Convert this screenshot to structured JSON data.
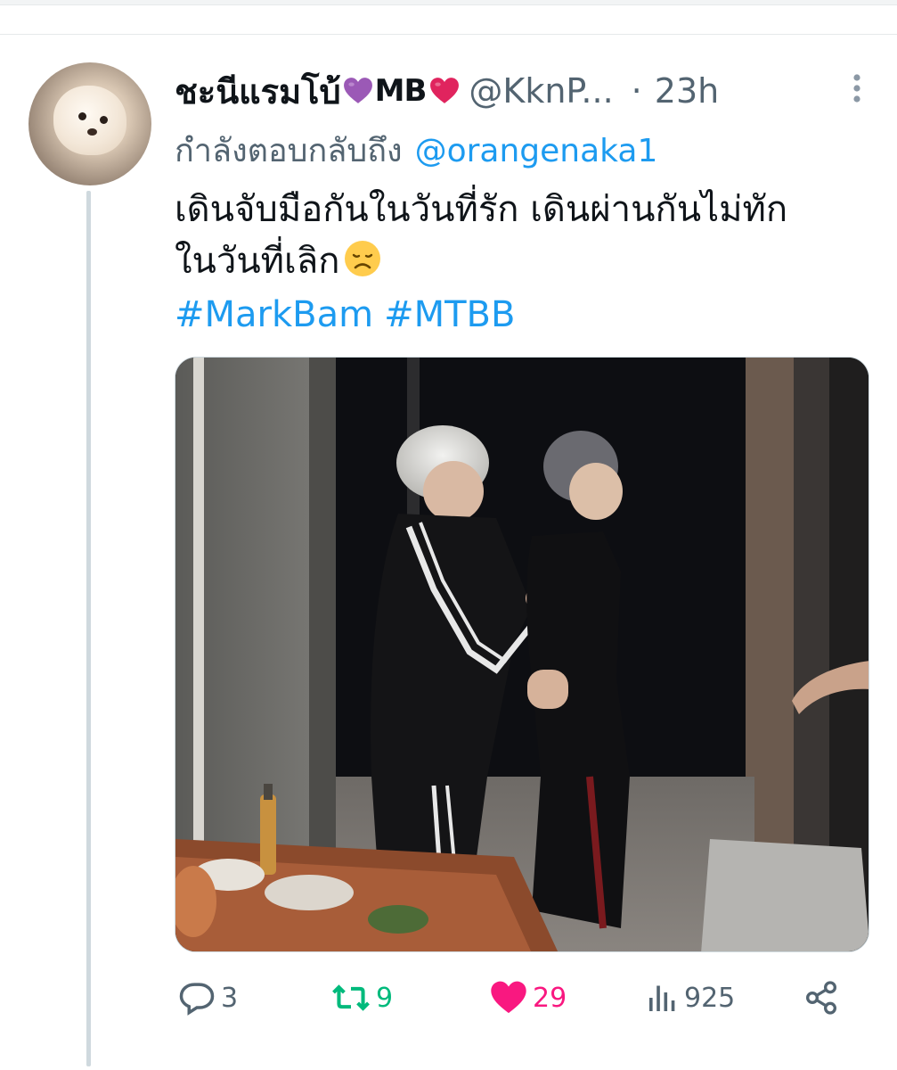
{
  "tweet": {
    "display_name": "ชะนีแรมโบ้",
    "name_suffix": "MB",
    "handle": "@KknP...",
    "dot": "·",
    "time": "23h",
    "reply_prefix": "กำลังตอบกลับถึง",
    "reply_mention": "@orangenaka1",
    "text_line1": "เดินจับมือกันในวันที่รัก เดินผ่านกันไม่ทัก",
    "text_line2": "ในวันที่เลิก",
    "hashtags": [
      "#MarkBam",
      "#MTBB"
    ]
  },
  "actions": {
    "replies": "3",
    "retweets": "9",
    "likes": "29",
    "views": "925"
  },
  "colors": {
    "accent": "#1d9bf0",
    "muted": "#536471",
    "retweet": "#00ba7c",
    "like": "#f91880",
    "purple_heart": "#9b59b6",
    "red_heart": "#e0245e"
  },
  "icons": [
    "more-icon",
    "purple-heart-icon",
    "red-heart-icon",
    "sad-face-emoji",
    "reply-icon",
    "retweet-icon",
    "like-icon",
    "views-icon",
    "share-icon"
  ]
}
